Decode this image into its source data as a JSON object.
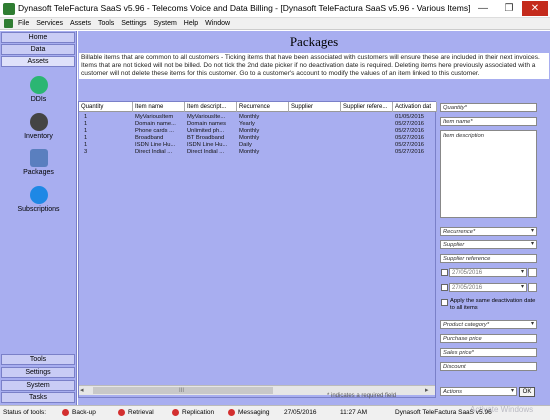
{
  "window": {
    "title": "Dynasoft TeleFactura SaaS v5.96 - Telecoms Voice and Data Billing - [Dynasoft TeleFactura SaaS v5.96 - Various Items]",
    "minimize": "—",
    "maximize": "❐",
    "close": "✕"
  },
  "menu": [
    "File",
    "Services",
    "Assets",
    "Tools",
    "Settings",
    "System",
    "Help",
    "Window"
  ],
  "sidebar": {
    "top_tabs": [
      "Home",
      "Data",
      "Assets"
    ],
    "modules": [
      {
        "label": "DDIs",
        "icon": "phone-icon"
      },
      {
        "label": "Inventory",
        "icon": "clock-icon"
      },
      {
        "label": "Packages",
        "icon": "packages-icon"
      },
      {
        "label": "Subscriptions",
        "icon": "cloud-icon"
      }
    ],
    "bottom_tabs": [
      "Tools",
      "Settings",
      "System",
      "Tasks"
    ]
  },
  "page": {
    "title": "Packages",
    "info": "Billable items that are common to all customers - Ticking items that have been associated with customers will ensure these are included in their next invoices. Items that are not ticked will not be billed. Do not tick the 2nd date picker if no deactivation date is required. Deleting items here previously associated with a customer will not delete these items for this customer. Go to a customer's account to modify the values of an item linked to this customer."
  },
  "table": {
    "columns": [
      "Quantity",
      "Item name",
      "Item descript...",
      "Recurrence",
      "Supplier",
      "Supplier refere...",
      "Activation dat"
    ],
    "rows": [
      [
        "1",
        "MyVariousItem",
        "MyVariousIte...",
        "Monthly",
        "",
        "",
        "01/05/2015"
      ],
      [
        "1",
        "Domain name...",
        "Domain names",
        "Yearly",
        "",
        "",
        "05/27/2016"
      ],
      [
        "1",
        "Phone cards ...",
        "Unlimited ph...",
        "Monthly",
        "",
        "",
        "05/27/2016"
      ],
      [
        "1",
        "Broadband",
        "BT Broadband",
        "Monthly",
        "",
        "",
        "05/27/2016"
      ],
      [
        "1",
        "ISDN Line Hu...",
        "ISDN Line Hu...",
        "Daily",
        "",
        "",
        "05/27/2016"
      ],
      [
        "3",
        "Direct Indial ...",
        "Direct Indial ...",
        "Monthly",
        "",
        "",
        "05/27/2016"
      ]
    ],
    "required_note": "* indicates a required field",
    "scroll_grip": "III"
  },
  "form": {
    "quantity_placeholder": "Quantity*",
    "item_name_placeholder": "Item name*",
    "description_placeholder": "Item description",
    "recurrence_placeholder": "Recurrence*",
    "supplier_placeholder": "Supplier",
    "supplier_reference_placeholder": "Supplier reference",
    "activation_date": "27/05/2016",
    "deactivation_date": "27/05/2016",
    "same_date_label": "Apply the same deactivation date to all items",
    "product_category_placeholder": "Product category*",
    "purchase_price_placeholder": "Purchase price",
    "sales_price_placeholder": "Sales price*",
    "discount_placeholder": "Discount",
    "actions_placeholder": "Actions",
    "ok_label": "OK"
  },
  "status": {
    "label": "Status of tools:",
    "items": [
      "Back-up",
      "Retrieval",
      "Replication",
      "Messaging"
    ],
    "date": "27/05/2016",
    "time": "11:27 AM",
    "app": "Dynasoft TeleFactura SaaS v5.96",
    "watermark": "Activate Windows",
    "indicator_color": "#d32f2f"
  },
  "colors": {
    "panel_background": "#a8aef0",
    "sidebar_tab": "#c9ccf5",
    "close_button": "#c42b1c"
  }
}
